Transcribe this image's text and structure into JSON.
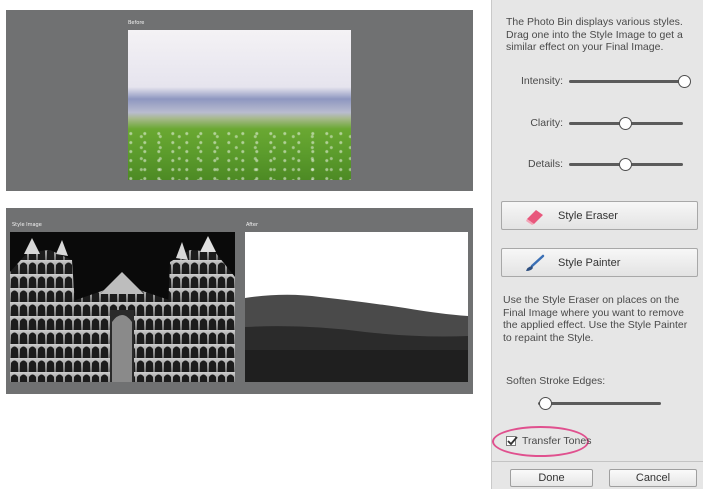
{
  "previews": {
    "before_label": "Before",
    "style_image_label": "Style Image",
    "after_label": "After"
  },
  "dialog": {
    "intro_text": "The Photo Bin displays various styles. Drag one into the Style Image to get a similar effect on your Final Image.",
    "sliders": [
      {
        "label": "Intensity:",
        "value": 1.0
      },
      {
        "label": "Clarity:",
        "value": 0.5
      },
      {
        "label": "Details:",
        "value": 0.5
      }
    ],
    "style_eraser_label": "Style Eraser",
    "style_painter_label": "Style Painter",
    "help_text": "Use the Style Eraser on places on the Final Image where you want to remove the applied effect. Use the Style Painter to repaint the Style.",
    "soften_label": "Soften Stroke Edges:",
    "soften_value": 0.0,
    "transfer_tones_label": "Transfer Tones",
    "transfer_tones_checked": true,
    "done_label": "Done",
    "cancel_label": "Cancel"
  },
  "colors": {
    "panel_gray": "#707172",
    "dialog_bg": "#e6e6e6",
    "highlight": "#e0508e"
  }
}
